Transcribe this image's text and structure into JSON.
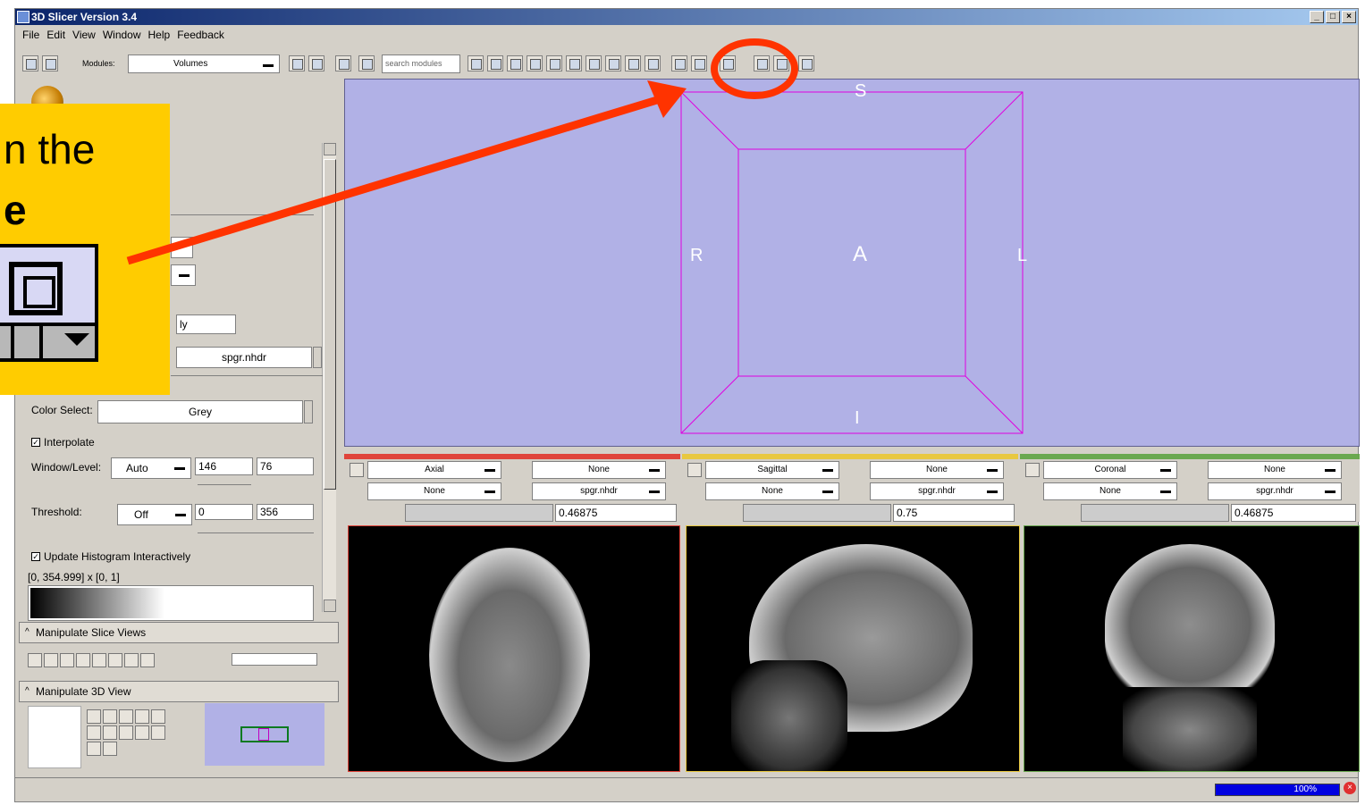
{
  "window": {
    "title": "3D Slicer Version 3.4"
  },
  "menu": [
    "File",
    "Edit",
    "View",
    "Window",
    "Help",
    "Feedback"
  ],
  "toolbar": {
    "modules_label": "Modules:",
    "module_selected": "Volumes",
    "search_placeholder": "search modules"
  },
  "callout": {
    "line1": "n the",
    "line2": "e"
  },
  "panel": {
    "display_suffix": "ly",
    "volume_select": "spgr.nhdr",
    "color_select_label": "Color Select:",
    "color_select_value": "Grey",
    "interpolate_label": "Interpolate",
    "window_level_label": "Window/Level:",
    "window_level_mode": "Auto",
    "window_value": "146",
    "level_value": "76",
    "threshold_label": "Threshold:",
    "threshold_mode": "Off",
    "threshold_low": "0",
    "threshold_high": "356",
    "update_histogram_label": "Update Histogram Interactively",
    "histogram_range": "[0, 354.999] x [0, 1]"
  },
  "sections": {
    "slice_views": "Manipulate Slice Views",
    "view3d": "Manipulate 3D View"
  },
  "view3d": {
    "labels": {
      "superior": "S",
      "inferior": "I",
      "right": "R",
      "left": "L",
      "anterior": "A"
    }
  },
  "slices": [
    {
      "name": "Axial",
      "band": "#e0443a",
      "fg": "None",
      "bg": "spgr.nhdr",
      "label": "None",
      "label2": "None",
      "offset": "0.46875"
    },
    {
      "name": "Sagittal",
      "band": "#e8c840",
      "fg": "None",
      "bg": "spgr.nhdr",
      "label": "None",
      "label2": "None",
      "offset": "0.75"
    },
    {
      "name": "Coronal",
      "band": "#6aa84f",
      "fg": "None",
      "bg": "spgr.nhdr",
      "label": "None",
      "label2": "None",
      "offset": "0.46875"
    }
  ],
  "status": {
    "progress": "100%"
  },
  "colors": {
    "accent_red": "#ff3300",
    "view3d_bg": "#b1b1e6",
    "callout_bg": "#ffcc00"
  }
}
